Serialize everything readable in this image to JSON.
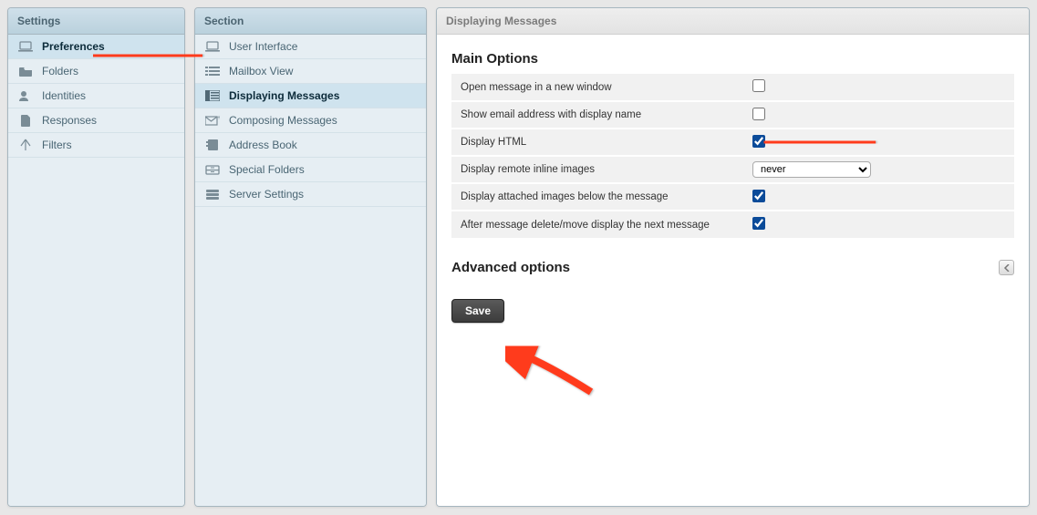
{
  "settings": {
    "header": "Settings",
    "items": [
      {
        "label": "Preferences",
        "icon": "laptop-icon",
        "selected": true
      },
      {
        "label": "Folders",
        "icon": "folder-icon",
        "selected": false
      },
      {
        "label": "Identities",
        "icon": "identity-icon",
        "selected": false
      },
      {
        "label": "Responses",
        "icon": "document-icon",
        "selected": false
      },
      {
        "label": "Filters",
        "icon": "filter-icon",
        "selected": false
      }
    ]
  },
  "section": {
    "header": "Section",
    "items": [
      {
        "label": "User Interface",
        "icon": "laptop-icon",
        "selected": false
      },
      {
        "label": "Mailbox View",
        "icon": "list-icon",
        "selected": false
      },
      {
        "label": "Displaying Messages",
        "icon": "layout-icon",
        "selected": true
      },
      {
        "label": "Composing Messages",
        "icon": "compose-icon",
        "selected": false
      },
      {
        "label": "Address Book",
        "icon": "addressbook-icon",
        "selected": false
      },
      {
        "label": "Special Folders",
        "icon": "drawer-icon",
        "selected": false
      },
      {
        "label": "Server Settings",
        "icon": "server-icon",
        "selected": false
      }
    ]
  },
  "main": {
    "header": "Displaying Messages",
    "main_options_title": "Main Options",
    "advanced_title": "Advanced options",
    "save_label": "Save",
    "options": [
      {
        "label": "Open message in a new window",
        "type": "checkbox",
        "checked": false
      },
      {
        "label": "Show email address with display name",
        "type": "checkbox",
        "checked": false
      },
      {
        "label": "Display HTML",
        "type": "checkbox",
        "checked": true
      },
      {
        "label": "Display remote inline images",
        "type": "select",
        "value": "never"
      },
      {
        "label": "Display attached images below the message",
        "type": "checkbox",
        "checked": true
      },
      {
        "label": "After message delete/move display the next message",
        "type": "checkbox",
        "checked": true
      }
    ]
  }
}
